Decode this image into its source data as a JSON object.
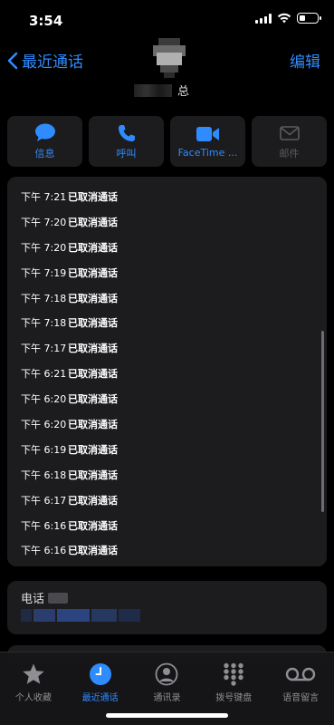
{
  "status": {
    "time": "3:54"
  },
  "nav": {
    "back_label": "最近通话",
    "edit_label": "编辑",
    "contact_suffix": "总"
  },
  "actions": [
    {
      "label": "信息",
      "icon": "message-icon",
      "enabled": true
    },
    {
      "label": "呼叫",
      "icon": "phone-icon",
      "enabled": true
    },
    {
      "label": "FaceTime ...",
      "icon": "video-icon",
      "enabled": true
    },
    {
      "label": "邮件",
      "icon": "mail-icon",
      "enabled": false
    }
  ],
  "calls": [
    {
      "time": "下午 7:21",
      "status": "已取消通话"
    },
    {
      "time": "下午 7:20",
      "status": "已取消通话"
    },
    {
      "time": "下午 7:20",
      "status": "已取消通话"
    },
    {
      "time": "下午 7:19",
      "status": "已取消通话"
    },
    {
      "time": "下午 7:18",
      "status": "已取消通话"
    },
    {
      "time": "下午 7:18",
      "status": "已取消通话"
    },
    {
      "time": "下午 7:17",
      "status": "已取消通话"
    },
    {
      "time": "下午 6:21",
      "status": "已取消通话"
    },
    {
      "time": "下午 6:20",
      "status": "已取消通话"
    },
    {
      "time": "下午 6:20",
      "status": "已取消通话"
    },
    {
      "time": "下午 6:19",
      "status": "已取消通话"
    },
    {
      "time": "下午 6:18",
      "status": "已取消通话"
    },
    {
      "time": "下午 6:17",
      "status": "已取消通话"
    },
    {
      "time": "下午 6:16",
      "status": "已取消通话"
    },
    {
      "time": "下午 6:16",
      "status": "已取消通话"
    }
  ],
  "phone": {
    "label": "电话"
  },
  "tabs": [
    {
      "label": "个人收藏",
      "icon": "star-icon",
      "active": false
    },
    {
      "label": "最近通话",
      "icon": "clock-icon",
      "active": true
    },
    {
      "label": "通讯录",
      "icon": "contact-icon",
      "active": false
    },
    {
      "label": "拨号键盘",
      "icon": "keypad-icon",
      "active": false
    },
    {
      "label": "语音留言",
      "icon": "voicemail-icon",
      "active": false
    }
  ],
  "colors": {
    "accent": "#2f8cff",
    "card": "#1c1c1e",
    "background": "#000000",
    "inactive": "#8e8e93"
  }
}
